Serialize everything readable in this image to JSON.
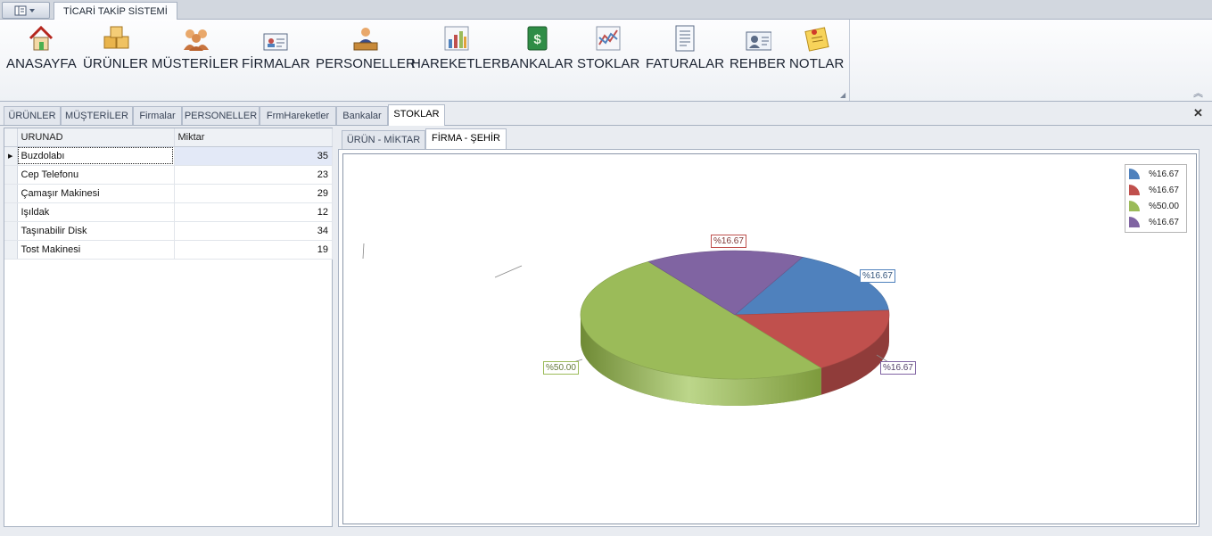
{
  "app": {
    "title": "TİCARİ TAKİP SİSTEMİ"
  },
  "ribbon": {
    "buttons": [
      {
        "label": "ANASAYFA",
        "icon": "home-icon"
      },
      {
        "label": "ÜRÜNLER",
        "icon": "boxes-icon"
      },
      {
        "label": "MÜSTERİLER",
        "icon": "people-icon"
      },
      {
        "label": "FİRMALAR",
        "icon": "id-card-icon"
      },
      {
        "label": "PERSONELLER",
        "icon": "employee-icon"
      },
      {
        "label": "HAREKETLER",
        "icon": "bar-chart-icon"
      },
      {
        "label": "BANKALAR",
        "icon": "money-book-icon"
      },
      {
        "label": "STOKLAR",
        "icon": "line-chart-icon"
      },
      {
        "label": "FATURALAR",
        "icon": "invoice-icon"
      },
      {
        "label": "REHBER",
        "icon": "contact-card-icon"
      },
      {
        "label": "NOTLAR",
        "icon": "sticky-note-icon"
      }
    ]
  },
  "doc_tabs": [
    "ÜRÜNLER",
    "MÜŞTERİLER",
    "Firmalar",
    "PERSONELLER",
    "FrmHareketler",
    "Bankalar",
    "STOKLAR"
  ],
  "active_doc_tab": "STOKLAR",
  "grid": {
    "columns": [
      "URUNAD",
      "Miktar"
    ],
    "rows": [
      {
        "name": "Buzdolabı",
        "qty": "35"
      },
      {
        "name": "Cep Telefonu",
        "qty": "23"
      },
      {
        "name": "Çamaşır Makinesi",
        "qty": "29"
      },
      {
        "name": "Işıldak",
        "qty": "12"
      },
      {
        "name": "Taşınabilir Disk",
        "qty": "34"
      },
      {
        "name": "Tost Makinesi",
        "qty": "19"
      }
    ]
  },
  "chart_tabs": [
    "ÜRÜN - MİKTAR",
    "FİRMA - ŞEHİR"
  ],
  "active_chart_tab": "FİRMA - ŞEHİR",
  "chart_data": {
    "type": "pie",
    "series": [
      {
        "label": "%16.67",
        "value": 16.67,
        "color": "#4f81bd"
      },
      {
        "label": "%16.67",
        "value": 16.67,
        "color": "#c0504d"
      },
      {
        "label": "%50.00",
        "value": 50.0,
        "color": "#9bbb59"
      },
      {
        "label": "%16.67",
        "value": 16.67,
        "color": "#8064a2"
      }
    ],
    "legend": "top-right"
  }
}
